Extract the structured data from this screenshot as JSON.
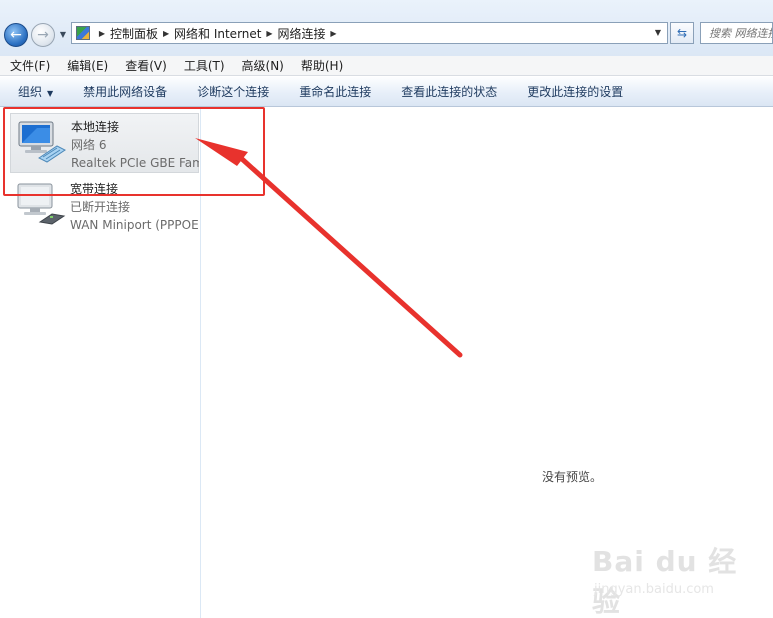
{
  "address_bar": {
    "breadcrumbs": [
      "控制面板",
      "网络和 Internet",
      "网络连接"
    ],
    "search_placeholder": "搜索 网络连接"
  },
  "menu": [
    "文件(F)",
    "编辑(E)",
    "查看(V)",
    "工具(T)",
    "高级(N)",
    "帮助(H)"
  ],
  "toolbar": {
    "organize": "组织",
    "disable": "禁用此网络设备",
    "diagnose": "诊断这个连接",
    "rename": "重命名此连接",
    "view_status": "查看此连接的状态",
    "change_settings": "更改此连接的设置"
  },
  "connections": [
    {
      "name": "本地连接",
      "status": "网络  6",
      "device": "Realtek PCIe GBE Family Controller",
      "selected": true
    },
    {
      "name": "宽带连接",
      "status": "已断开连接",
      "device": "WAN Miniport (PPPOE)",
      "selected": false
    }
  ],
  "preview": {
    "text": "没有预览。"
  },
  "watermark": {
    "logo": "Bai du 经验",
    "url": "jingyan.baidu.com"
  },
  "colors": {
    "annotation_red": "#e8322d",
    "command_bar": "#dbe6f4",
    "selection": "#e4e7ea"
  }
}
